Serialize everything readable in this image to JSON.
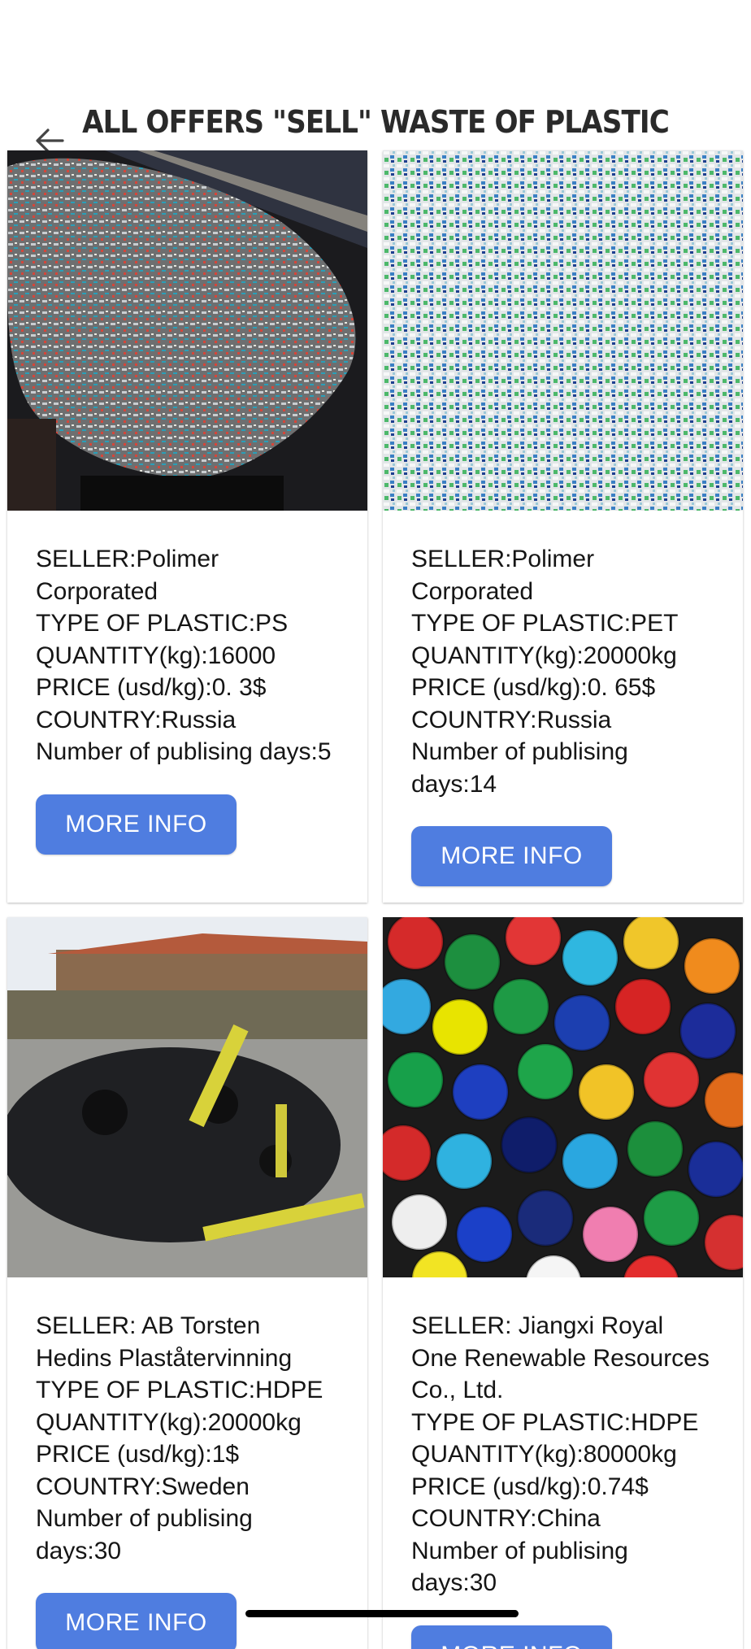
{
  "header": {
    "title": "ALL OFFERS \"SELL\"  WASTE OF PLASTIC",
    "back_icon": "arrow-left-icon"
  },
  "offers": [
    {
      "seller": "SELLER:Polimer Corporated",
      "type": "TYPE OF PLASTIC:PS",
      "quantity": "QUANTITY(kg):16000",
      "price": "PRICE (usd/kg):0. 3$",
      "country": "COUNTRY:Russia",
      "days": "Number of publising days:5",
      "button": "MORE INFO"
    },
    {
      "seller": "SELLER:Polimer Corporated",
      "type": "TYPE OF PLASTIC:PET",
      "quantity": "QUANTITY(kg):20000kg",
      "price": "PRICE (usd/kg):0. 65$",
      "country": "COUNTRY:Russia",
      "days": "Number of publising days:14",
      "button": "MORE INFO"
    },
    {
      "seller": "SELLER: AB Torsten Hedins Plaståtervinning",
      "type": "TYPE OF PLASTIC:HDPE",
      "quantity": "QUANTITY(kg):20000kg",
      "price": "PRICE (usd/kg):1$",
      "country": "COUNTRY:Sweden",
      "days": "Number of publising days:30",
      "button": "MORE INFO"
    },
    {
      "seller": "SELLER: Jiangxi Royal One Renewable Resources Co., Ltd.",
      "type": "TYPE OF PLASTIC:HDPE",
      "quantity": "QUANTITY(kg):80000kg",
      "price": "PRICE (usd/kg):0.74$",
      "country": "COUNTRY:China",
      "days": "Number of publising days:30",
      "button": "MORE INFO"
    }
  ]
}
